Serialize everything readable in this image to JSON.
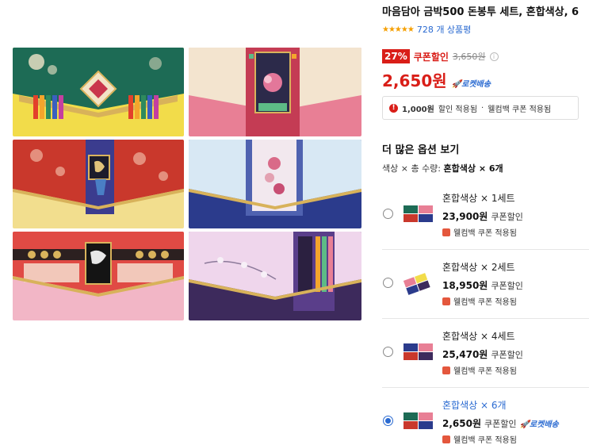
{
  "product": {
    "title": "마음담아 금박500 돈봉투 세트, 혼합색상, 6",
    "stars": "★★★★★",
    "review_count": "728 개 상품평",
    "discount_badge": "27%",
    "coupon_label": "쿠폰할인",
    "original_price": "3,650원",
    "info_icon": "i",
    "price": "2,650원",
    "rocket_label": "🚀로켓배송",
    "benefit": {
      "icon": "!",
      "amount": "1,000원",
      "text": "할인 적용됨",
      "dot": "·",
      "welcome": "웰컴백 쿠폰 적용됨"
    }
  },
  "options": {
    "title": "더 많은 옵션 보기",
    "summary_prefix": "색상 × 총 수량:",
    "summary_value": "혼합색상 × 6개",
    "items": [
      {
        "name": "혼합색상 × 1세트",
        "price": "23,900원",
        "coupon": "쿠폰할인",
        "rocket": "",
        "welcome": "웰컴백 쿠폰 적용됨",
        "selected": false
      },
      {
        "name": "혼합색상 × 2세트",
        "price": "18,950원",
        "coupon": "쿠폰할인",
        "rocket": "",
        "welcome": "웰컴백 쿠폰 적용됨",
        "selected": false
      },
      {
        "name": "혼합색상 × 4세트",
        "price": "25,470원",
        "coupon": "쿠폰할인",
        "rocket": "",
        "welcome": "웰컴백 쿠폰 적용됨",
        "selected": false
      },
      {
        "name": "혼합색상 × 6개",
        "price": "2,650원",
        "coupon": "쿠폰할인",
        "rocket": "🚀로켓배송",
        "welcome": "웰컴백 쿠폰 적용됨",
        "selected": true
      }
    ]
  },
  "colors": {
    "accent_red": "#d91e18",
    "accent_blue": "#2a6ad1"
  }
}
